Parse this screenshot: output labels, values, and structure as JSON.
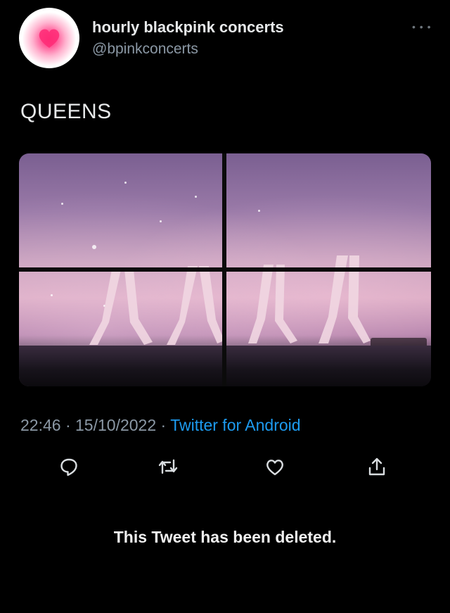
{
  "tweet": {
    "display_name": "hourly blackpink concerts",
    "handle": "@bpinkconcerts",
    "more_icon": "ellipsis-icon",
    "text": "QUEENS",
    "time": "22:46",
    "date": "15/10/2022",
    "separator": "·",
    "source": "Twitter for Android"
  },
  "actions": [
    {
      "name": "reply",
      "icon": "reply-icon"
    },
    {
      "name": "retweet",
      "icon": "retweet-icon"
    },
    {
      "name": "like",
      "icon": "heart-icon"
    },
    {
      "name": "share",
      "icon": "share-icon"
    }
  ],
  "notice": {
    "deleted": "This Tweet has been deleted."
  },
  "colors": {
    "background": "#000000",
    "text": "#e7e9ea",
    "secondary": "#8b98a5",
    "accent": "#1d9bf0"
  }
}
